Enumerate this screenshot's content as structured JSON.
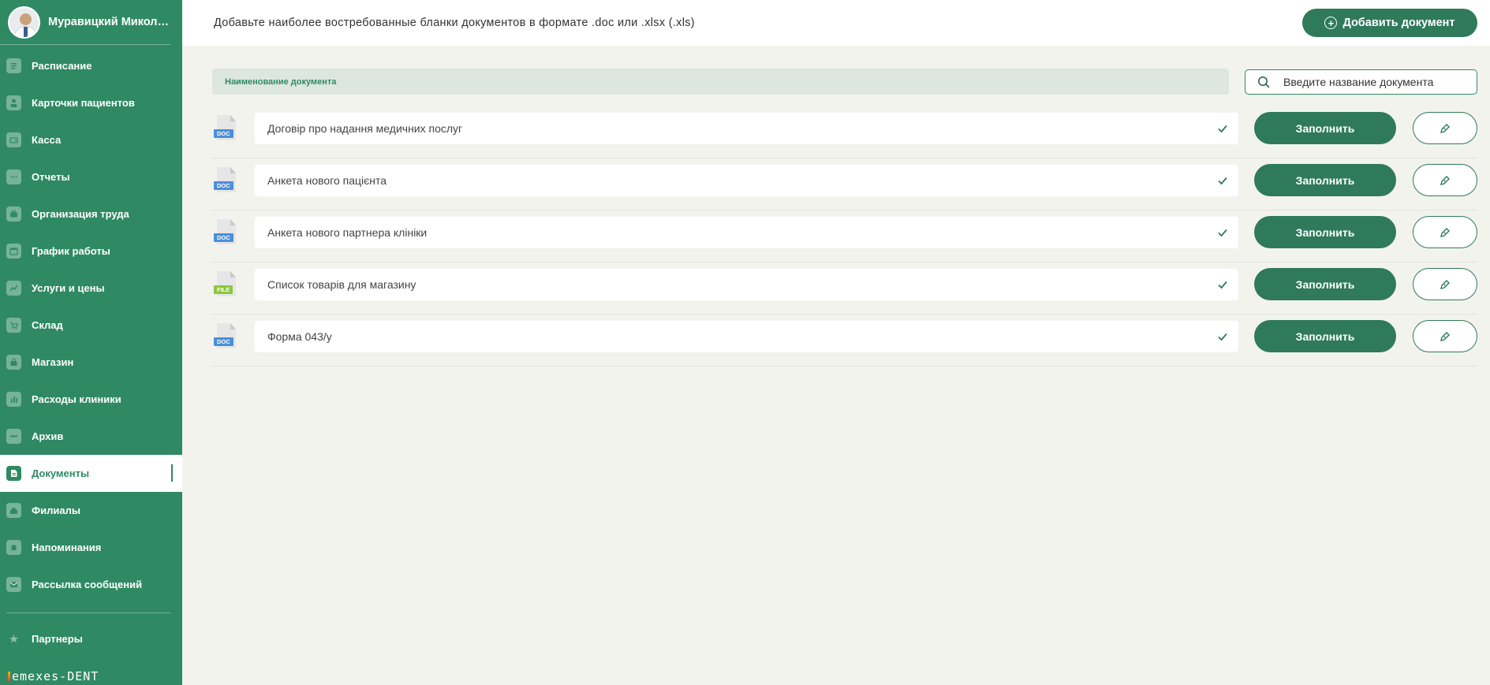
{
  "user": {
    "name": "Муравицкий Миколай"
  },
  "sidebar": {
    "items": [
      {
        "label": "Расписание",
        "icon": "calendar-list-icon"
      },
      {
        "label": "Карточки пациентов",
        "icon": "patients-icon"
      },
      {
        "label": "Касса",
        "icon": "wallet-icon"
      },
      {
        "label": "Отчеты",
        "icon": "reports-icon"
      },
      {
        "label": "Организация труда",
        "icon": "briefcase-icon"
      },
      {
        "label": "График работы",
        "icon": "schedule-icon"
      },
      {
        "label": "Услуги и цены",
        "icon": "chart-icon"
      },
      {
        "label": "Склад",
        "icon": "cart-icon"
      },
      {
        "label": "Магазин",
        "icon": "bag-icon"
      },
      {
        "label": "Расходы клиники",
        "icon": "expenses-icon"
      },
      {
        "label": "Архив",
        "icon": "archive-icon"
      },
      {
        "label": "Документы",
        "icon": "document-icon",
        "active": true
      },
      {
        "label": "Филиалы",
        "icon": "home-icon"
      },
      {
        "label": "Напоминания",
        "icon": "bell-icon"
      },
      {
        "label": "Рассылка сообщений",
        "icon": "mail-icon"
      }
    ],
    "partners_label": "Партнеры",
    "logo_text": "emexes-DENT"
  },
  "header": {
    "title": "Добавьте наиболее востребованные бланки документов в формате .doc или .xlsx (.xls)",
    "add_button_label": "Добавить документ"
  },
  "table": {
    "column_header": "Наименование документа"
  },
  "search": {
    "placeholder": "Введите название документа"
  },
  "documents": [
    {
      "type": "DOC",
      "name": "Договір про надання медичних послуг",
      "fill_label": "Заполнить"
    },
    {
      "type": "DOC",
      "name": "Анкета нового пацієнта",
      "fill_label": "Заполнить"
    },
    {
      "type": "DOC",
      "name": "Анкета нового партнера клініки",
      "fill_label": "Заполнить"
    },
    {
      "type": "FILE",
      "name": "Список товарів для магазину",
      "fill_label": "Заполнить"
    },
    {
      "type": "DOC",
      "name": "Форма 043/у",
      "fill_label": "Заполнить"
    }
  ],
  "colors": {
    "primary": "#2f8a63",
    "button": "#2f7a5a",
    "background": "#f3f3ee",
    "header_row": "#dde7df"
  }
}
